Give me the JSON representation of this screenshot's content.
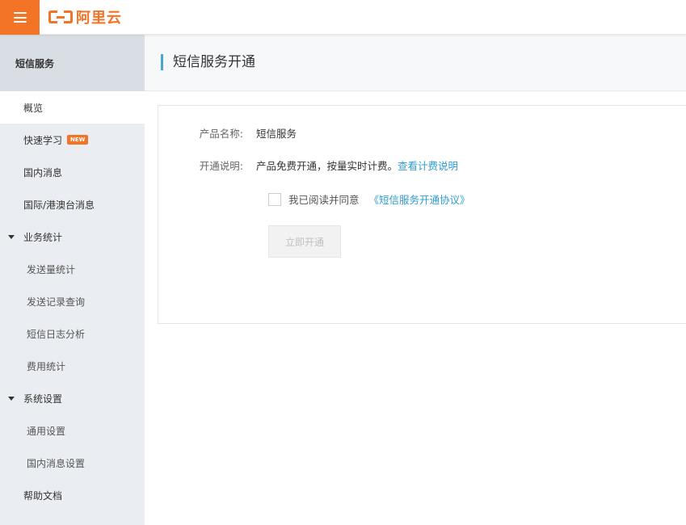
{
  "header": {
    "logo_text": "阿里云",
    "brand_color": "#f37327"
  },
  "sidebar": {
    "title": "短信服务",
    "items": [
      {
        "label": "概览",
        "active": true
      },
      {
        "label": "快速学习",
        "badge": "NEW"
      },
      {
        "label": "国内消息"
      },
      {
        "label": "国际/港澳台消息"
      },
      {
        "label": "业务统计",
        "group": true
      },
      {
        "label": "发送量统计"
      },
      {
        "label": "发送记录查询"
      },
      {
        "label": "短信日志分析"
      },
      {
        "label": "费用统计"
      },
      {
        "label": "系统设置",
        "group": true
      },
      {
        "label": "通用设置"
      },
      {
        "label": "国内消息设置"
      },
      {
        "label": "帮助文档"
      }
    ]
  },
  "main": {
    "page_title": "短信服务开通",
    "product_name_label": "产品名称:",
    "product_name_value": "短信服务",
    "description_label": "开通说明:",
    "description_value": "产品免费开通，按量实时计费。",
    "pricing_link": "查看计费说明",
    "agree_text": "我已阅读并同意",
    "agreement_link": "《短信服务开通协议》",
    "agree_checked": false,
    "open_button": "立即开通",
    "link_color": "#2e9cd4"
  }
}
